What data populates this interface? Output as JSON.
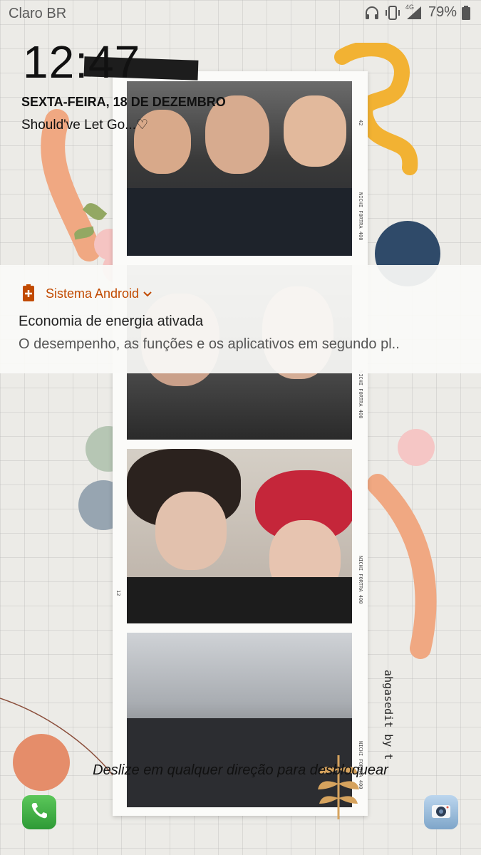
{
  "status_bar": {
    "carrier": "Claro BR",
    "network": "4G",
    "battery": "79%",
    "icons": [
      "headphones-icon",
      "vibrate-icon",
      "signal-icon",
      "battery-icon"
    ]
  },
  "lockscreen": {
    "time": "12:47",
    "date": "SEXTA-FEIRA, 18 DE DEZEMBRO",
    "owner_info": "Should've Let Go...♡",
    "unlock_hint": "Deslize em qualquer direção para desbloquear"
  },
  "notification": {
    "app_name": "Sistema Android",
    "title": "Economia de energia ativada",
    "body": "O desempenho, as funções e os aplicativos em segundo pl..",
    "accent": "#c14a00"
  },
  "wallpaper": {
    "watermark": "ahgasedit by t",
    "strip_label": "NICHI FORTRA 400",
    "frame_numbers": [
      "42",
      "12"
    ]
  },
  "shortcuts": {
    "left": "phone-icon",
    "right": "camera-icon"
  }
}
